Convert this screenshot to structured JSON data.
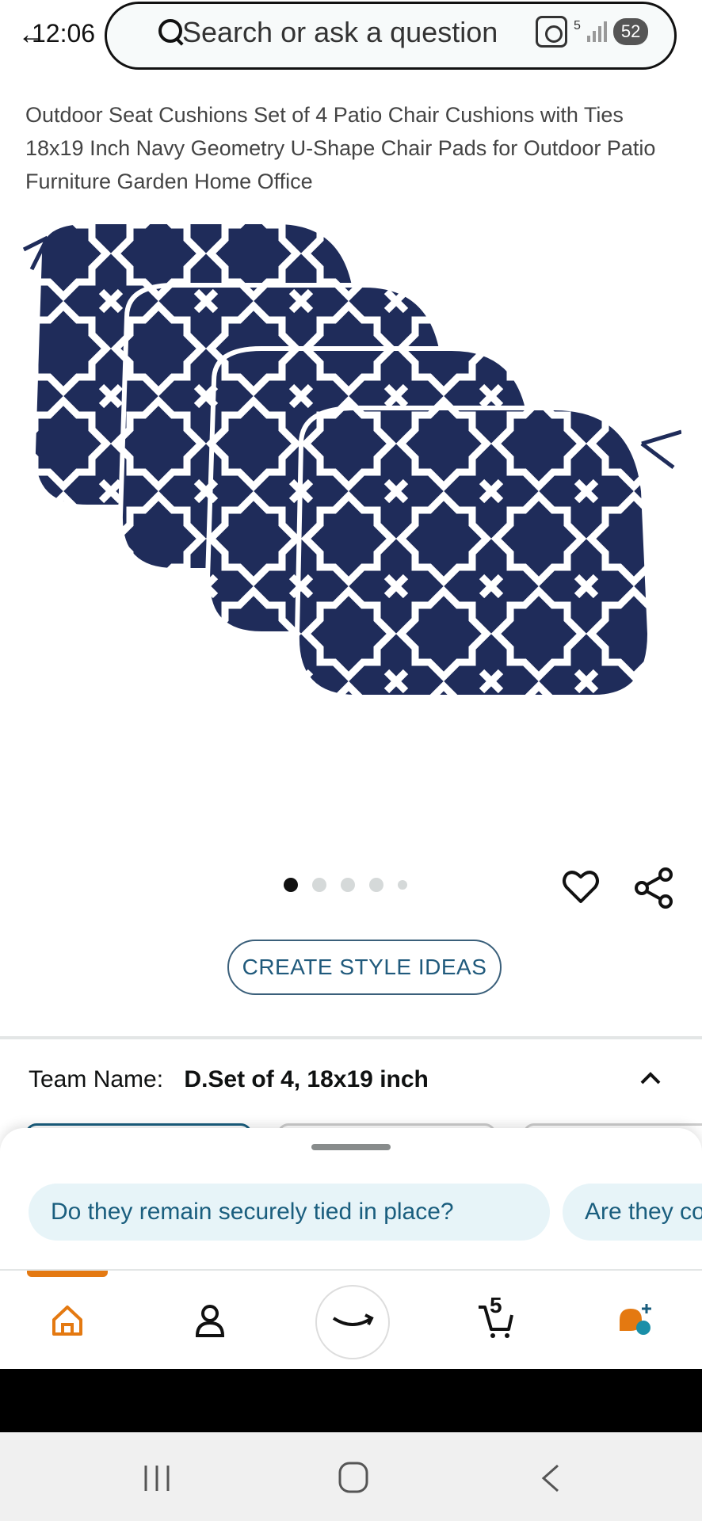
{
  "status_bar": {
    "time": "12:06",
    "wifi_badge": "5",
    "camera_badge": "52"
  },
  "search": {
    "placeholder": "Search or ask a question"
  },
  "product": {
    "title": "Outdoor Seat Cushions Set of 4 Patio Chair Cushions with Ties 18x19 Inch Navy Geometry U-Shape Chair Pads for Outdoor Patio Furniture Garden Home Office",
    "image_count": 5,
    "active_image_index": 0
  },
  "actions": {
    "create_style_ideas": "CREATE STYLE IDEAS"
  },
  "variation": {
    "label": "Team Name:",
    "value": "D.Set of 4, 18x19 inch"
  },
  "suggestions": [
    "Do they remain securely tied in place?",
    "Are they comfortable"
  ],
  "bottom_nav": {
    "items": [
      "home-icon",
      "account-icon",
      "rufus-icon",
      "cart-icon",
      "ai-assistant-icon"
    ],
    "cart_count": "5",
    "accent_color": "#e47911"
  },
  "colors": {
    "cushion_navy": "#1f2c5a",
    "link_blue": "#205a7c",
    "chip_bg": "#e7f4f8"
  }
}
